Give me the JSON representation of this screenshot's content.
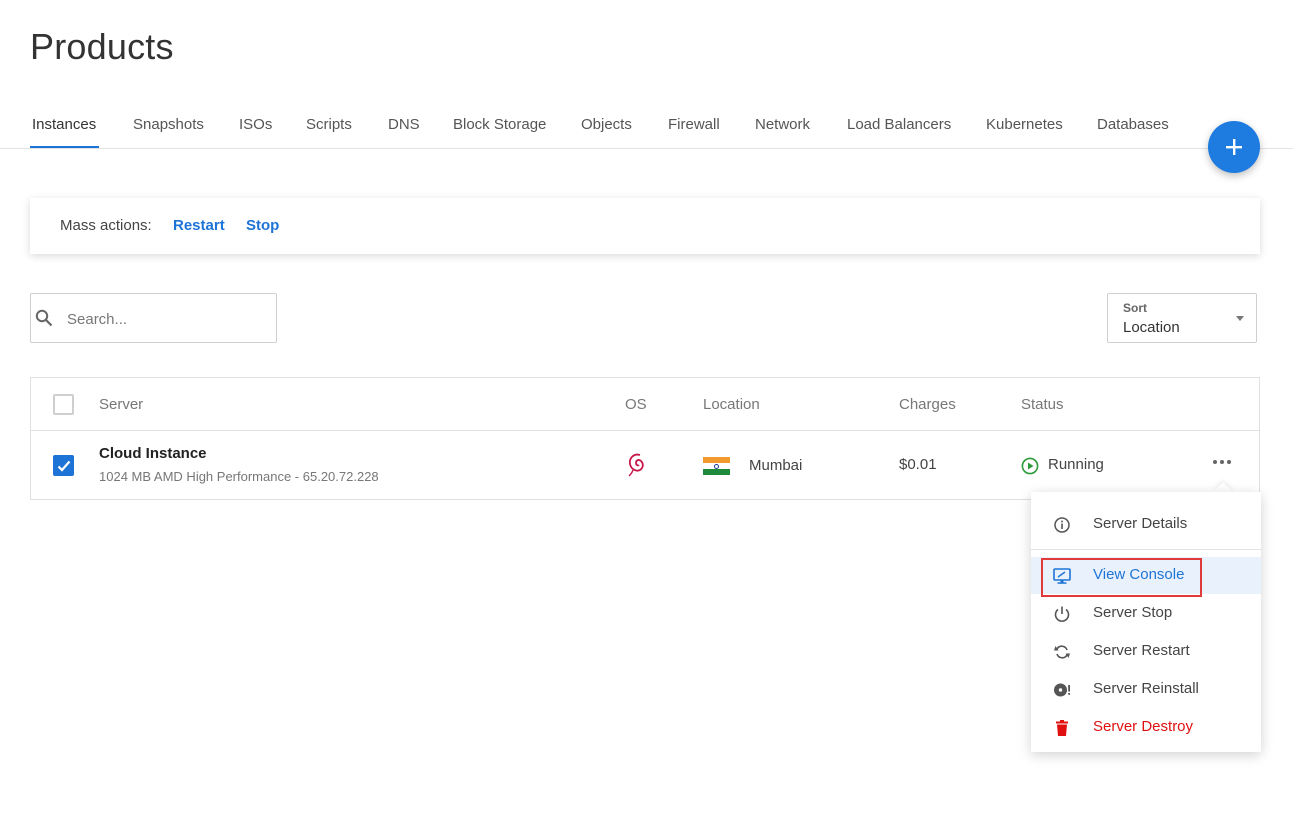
{
  "page": {
    "title": "Products"
  },
  "tabs": [
    {
      "label": "Instances",
      "active": true
    },
    {
      "label": "Snapshots"
    },
    {
      "label": "ISOs"
    },
    {
      "label": "Scripts"
    },
    {
      "label": "DNS"
    },
    {
      "label": "Block Storage"
    },
    {
      "label": "Objects"
    },
    {
      "label": "Firewall"
    },
    {
      "label": "Network"
    },
    {
      "label": "Load Balancers"
    },
    {
      "label": "Kubernetes"
    },
    {
      "label": "Databases"
    }
  ],
  "fab": {
    "icon": "plus-icon",
    "color": "#1e7be0"
  },
  "mass_actions": {
    "label": "Mass actions:",
    "restart": "Restart",
    "stop": "Stop"
  },
  "search": {
    "placeholder": "Search...",
    "value": ""
  },
  "sort": {
    "caption": "Sort",
    "value": "Location"
  },
  "table": {
    "headers": {
      "server": "Server",
      "os": "OS",
      "location": "Location",
      "charges": "Charges",
      "status": "Status"
    },
    "rows": [
      {
        "checked": true,
        "name": "Cloud Instance",
        "details": "1024 MB AMD High Performance - 65.20.72.228",
        "os_icon": "debian-icon",
        "flag_icon": "india-flag-icon",
        "location": "Mumbai",
        "charges": "$0.01",
        "status": "Running",
        "status_color": "#2e9b3a"
      }
    ]
  },
  "context_menu": {
    "items": [
      {
        "label": "Server Details",
        "icon": "info-icon"
      },
      {
        "label": "View Console",
        "icon": "monitor-icon",
        "highlighted": true
      },
      {
        "label": "Server Stop",
        "icon": "power-icon"
      },
      {
        "label": "Server Restart",
        "icon": "restart-icon"
      },
      {
        "label": "Server Reinstall",
        "icon": "disc-icon"
      },
      {
        "label": "Server Destroy",
        "icon": "trash-icon",
        "danger": true,
        "color": "#e01010"
      }
    ]
  },
  "colors": {
    "accent": "#1e74d6",
    "danger": "#e01010",
    "success": "#2e9b3a"
  }
}
